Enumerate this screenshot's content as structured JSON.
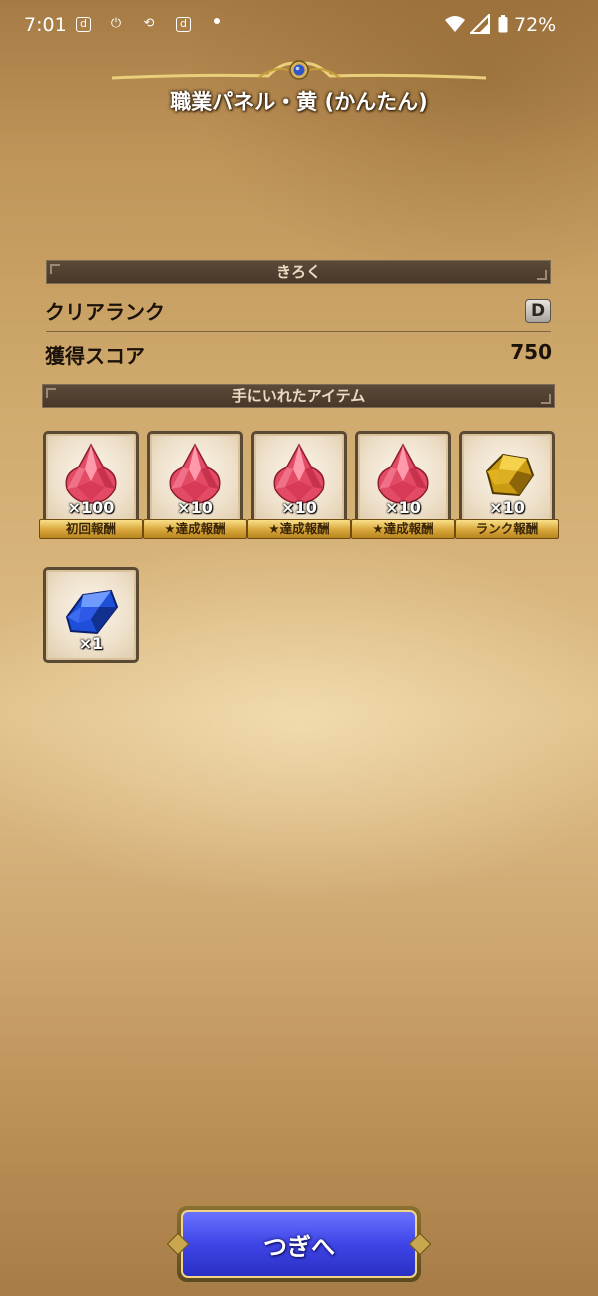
{
  "status_bar": {
    "time": "7:01",
    "icons": [
      "docomo-d-icon",
      "power-icon",
      "sync-icon",
      "docomo-d-icon",
      "dot-icon",
      "wifi-icon",
      "signal-icon",
      "battery-icon"
    ],
    "battery_percent": "72%"
  },
  "header": {
    "title": "職業パネル・黄 (かんたん)"
  },
  "record": {
    "section_title": "きろく",
    "clear_rank_label": "クリアランク",
    "clear_rank_value": "D",
    "score_label": "獲得スコア",
    "score_value": "750"
  },
  "items": {
    "section_title": "手にいれたアイテム",
    "list": [
      {
        "icon": "red-gem-icon",
        "quantity": "×100",
        "tag": "初回報酬"
      },
      {
        "icon": "red-gem-icon",
        "quantity": "×10",
        "tag": "★達成報酬"
      },
      {
        "icon": "red-gem-icon",
        "quantity": "×10",
        "tag": "★達成報酬"
      },
      {
        "icon": "red-gem-icon",
        "quantity": "×10",
        "tag": "★達成報酬"
      },
      {
        "icon": "gold-ore-icon",
        "quantity": "×10",
        "tag": "ランク報酬"
      },
      {
        "icon": "blue-ore-icon",
        "quantity": "×1",
        "tag": ""
      }
    ]
  },
  "footer": {
    "next_label": "つぎへ"
  },
  "colors": {
    "button_blue": "#3e45e6",
    "ribbon_gold": "#d8a63a",
    "section_bar": "#4f4030"
  }
}
